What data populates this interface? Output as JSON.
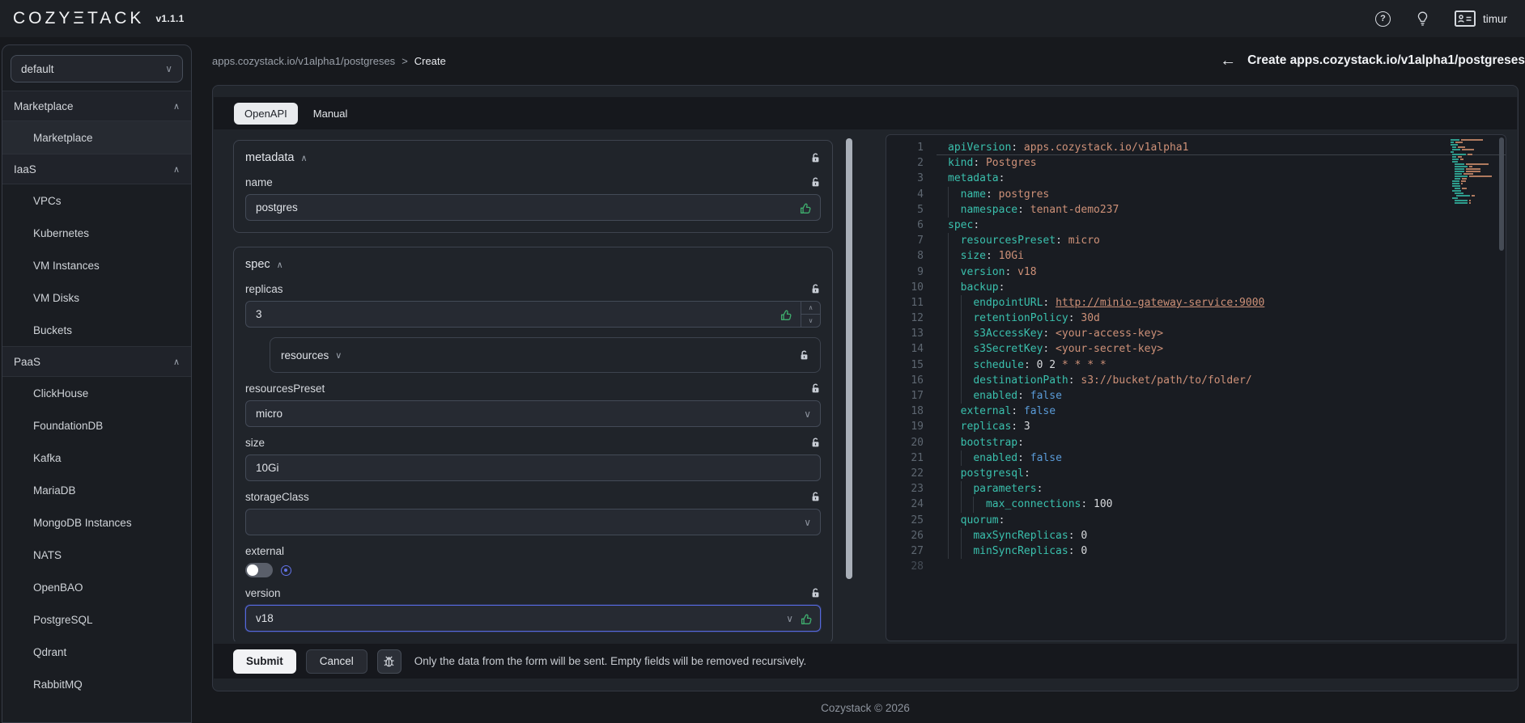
{
  "topbar": {
    "logo": "COZYΞTACK",
    "version": "v1.1.1",
    "user": "timur"
  },
  "sidebar": {
    "tenant_selector": "default",
    "groups": [
      {
        "label": "Marketplace",
        "expanded": true,
        "items": [
          {
            "label": "Marketplace",
            "active": true
          }
        ]
      },
      {
        "label": "IaaS",
        "expanded": true,
        "items": [
          {
            "label": "VPCs"
          },
          {
            "label": "Kubernetes"
          },
          {
            "label": "VM Instances"
          },
          {
            "label": "VM Disks"
          },
          {
            "label": "Buckets"
          }
        ]
      },
      {
        "label": "PaaS",
        "expanded": true,
        "items": [
          {
            "label": "ClickHouse"
          },
          {
            "label": "FoundationDB"
          },
          {
            "label": "Kafka"
          },
          {
            "label": "MariaDB"
          },
          {
            "label": "MongoDB Instances"
          },
          {
            "label": "NATS"
          },
          {
            "label": "OpenBAO"
          },
          {
            "label": "PostgreSQL"
          },
          {
            "label": "Qdrant"
          },
          {
            "label": "RabbitMQ"
          }
        ]
      }
    ]
  },
  "breadcrumb": {
    "path": "apps.cozystack.io/v1alpha1/postgreses",
    "separator": ">",
    "current": "Create"
  },
  "page_header": {
    "back_arrow": "←",
    "title": "Create apps.cozystack.io/v1alpha1/postgreses"
  },
  "main": {
    "tabs": [
      {
        "label": "OpenAPI",
        "active": true
      },
      {
        "label": "Manual",
        "active": false
      }
    ],
    "form": {
      "sections": [
        {
          "title": "metadata",
          "caret": "∧",
          "lock": true,
          "fields": [
            {
              "kind": "text",
              "label": "name",
              "value": "postgres",
              "lock": true,
              "thumb": true
            }
          ]
        },
        {
          "title": "spec",
          "caret": "∧",
          "lock": false,
          "fields": [
            {
              "kind": "number",
              "label": "replicas",
              "value": "3",
              "lock": true,
              "thumb": true
            },
            {
              "kind": "group",
              "label": "resources",
              "caret": "∨",
              "lock": true
            },
            {
              "kind": "select",
              "label": "resourcesPreset",
              "value": "micro",
              "lock": true
            },
            {
              "kind": "text",
              "label": "size",
              "value": "10Gi",
              "lock": true
            },
            {
              "kind": "select",
              "label": "storageClass",
              "value": "",
              "lock": true
            },
            {
              "kind": "toggle",
              "label": "external",
              "value": false,
              "lock": false
            },
            {
              "kind": "select",
              "label": "version",
              "value": "v18",
              "lock": true,
              "thumb": true,
              "focused": true
            }
          ]
        }
      ]
    },
    "actions": {
      "submit_label": "Submit",
      "cancel_label": "Cancel",
      "note": "Only the data from the form will be sent. Empty fields will be removed recursively."
    }
  },
  "editor": {
    "language": "yaml",
    "lines": [
      {
        "n": 1,
        "tokens": [
          [
            "k",
            "apiVersion"
          ],
          [
            "p",
            ":"
          ],
          [
            "s",
            " apps.cozystack.io/v1alpha1"
          ]
        ]
      },
      {
        "n": 2,
        "tokens": [
          [
            "k",
            "kind"
          ],
          [
            "p",
            ":"
          ],
          [
            "s",
            " Postgres"
          ]
        ]
      },
      {
        "n": 3,
        "tokens": [
          [
            "k",
            "metadata"
          ],
          [
            "p",
            ":"
          ]
        ]
      },
      {
        "n": 4,
        "tokens": [
          [
            "w",
            "  "
          ],
          [
            "k",
            "name"
          ],
          [
            "p",
            ":"
          ],
          [
            "s",
            " postgres"
          ]
        ]
      },
      {
        "n": 5,
        "tokens": [
          [
            "w",
            "  "
          ],
          [
            "k",
            "namespace"
          ],
          [
            "p",
            ":"
          ],
          [
            "s",
            " tenant-demo237"
          ]
        ]
      },
      {
        "n": 6,
        "tokens": [
          [
            "k",
            "spec"
          ],
          [
            "p",
            ":"
          ]
        ]
      },
      {
        "n": 7,
        "tokens": [
          [
            "w",
            "  "
          ],
          [
            "k",
            "resourcesPreset"
          ],
          [
            "p",
            ":"
          ],
          [
            "s",
            " micro"
          ]
        ]
      },
      {
        "n": 8,
        "tokens": [
          [
            "w",
            "  "
          ],
          [
            "k",
            "size"
          ],
          [
            "p",
            ":"
          ],
          [
            "s",
            " 10Gi"
          ]
        ]
      },
      {
        "n": 9,
        "tokens": [
          [
            "w",
            "  "
          ],
          [
            "k",
            "version"
          ],
          [
            "p",
            ":"
          ],
          [
            "s",
            " v18"
          ]
        ]
      },
      {
        "n": 10,
        "tokens": [
          [
            "w",
            "  "
          ],
          [
            "k",
            "backup"
          ],
          [
            "p",
            ":"
          ]
        ]
      },
      {
        "n": 11,
        "tokens": [
          [
            "w",
            "    "
          ],
          [
            "k",
            "endpointURL"
          ],
          [
            "p",
            ":"
          ],
          [
            "w",
            " "
          ],
          [
            "l",
            "http://minio-gateway-service:9000"
          ]
        ]
      },
      {
        "n": 12,
        "tokens": [
          [
            "w",
            "    "
          ],
          [
            "k",
            "retentionPolicy"
          ],
          [
            "p",
            ":"
          ],
          [
            "s",
            " 30d"
          ]
        ]
      },
      {
        "n": 13,
        "tokens": [
          [
            "w",
            "    "
          ],
          [
            "k",
            "s3AccessKey"
          ],
          [
            "p",
            ":"
          ],
          [
            "s",
            " <your-access-key>"
          ]
        ]
      },
      {
        "n": 14,
        "tokens": [
          [
            "w",
            "    "
          ],
          [
            "k",
            "s3SecretKey"
          ],
          [
            "p",
            ":"
          ],
          [
            "s",
            " <your-secret-key>"
          ]
        ]
      },
      {
        "n": 15,
        "tokens": [
          [
            "w",
            "    "
          ],
          [
            "k",
            "schedule"
          ],
          [
            "p",
            ":"
          ],
          [
            "n",
            " 0 2"
          ],
          [
            "s",
            " * * * *"
          ]
        ]
      },
      {
        "n": 16,
        "tokens": [
          [
            "w",
            "    "
          ],
          [
            "k",
            "destinationPath"
          ],
          [
            "p",
            ":"
          ],
          [
            "s",
            " s3://bucket/path/to/folder/"
          ]
        ]
      },
      {
        "n": 17,
        "tokens": [
          [
            "w",
            "    "
          ],
          [
            "k",
            "enabled"
          ],
          [
            "p",
            ":"
          ],
          [
            "b",
            " false"
          ]
        ]
      },
      {
        "n": 18,
        "tokens": [
          [
            "w",
            "  "
          ],
          [
            "k",
            "external"
          ],
          [
            "p",
            ":"
          ],
          [
            "b",
            " false"
          ]
        ]
      },
      {
        "n": 19,
        "tokens": [
          [
            "w",
            "  "
          ],
          [
            "k",
            "replicas"
          ],
          [
            "p",
            ":"
          ],
          [
            "n",
            " 3"
          ]
        ]
      },
      {
        "n": 20,
        "tokens": [
          [
            "w",
            "  "
          ],
          [
            "k",
            "bootstrap"
          ],
          [
            "p",
            ":"
          ]
        ]
      },
      {
        "n": 21,
        "tokens": [
          [
            "w",
            "    "
          ],
          [
            "k",
            "enabled"
          ],
          [
            "p",
            ":"
          ],
          [
            "b",
            " false"
          ]
        ]
      },
      {
        "n": 22,
        "tokens": [
          [
            "w",
            "  "
          ],
          [
            "k",
            "postgresql"
          ],
          [
            "p",
            ":"
          ]
        ]
      },
      {
        "n": 23,
        "tokens": [
          [
            "w",
            "    "
          ],
          [
            "k",
            "parameters"
          ],
          [
            "p",
            ":"
          ]
        ]
      },
      {
        "n": 24,
        "tokens": [
          [
            "w",
            "      "
          ],
          [
            "k",
            "max_connections"
          ],
          [
            "p",
            ":"
          ],
          [
            "n",
            " 100"
          ]
        ]
      },
      {
        "n": 25,
        "tokens": [
          [
            "w",
            "  "
          ],
          [
            "k",
            "quorum"
          ],
          [
            "p",
            ":"
          ]
        ]
      },
      {
        "n": 26,
        "tokens": [
          [
            "w",
            "    "
          ],
          [
            "k",
            "maxSyncReplicas"
          ],
          [
            "p",
            ":"
          ],
          [
            "n",
            " 0"
          ]
        ]
      },
      {
        "n": 27,
        "tokens": [
          [
            "w",
            "    "
          ],
          [
            "k",
            "minSyncReplicas"
          ],
          [
            "p",
            ":"
          ],
          [
            "n",
            " 0"
          ]
        ]
      },
      {
        "n": 28,
        "tokens": []
      }
    ]
  },
  "footer": {
    "copyright": "Cozystack © 2026"
  },
  "colors": {
    "accent_green": "#3fae6e",
    "focus_blue": "#5568dd",
    "yaml_key": "#3ac0ad",
    "yaml_string": "#ce9178",
    "yaml_bool": "#5a9bd8",
    "toggle_accent": "#6273e8"
  }
}
